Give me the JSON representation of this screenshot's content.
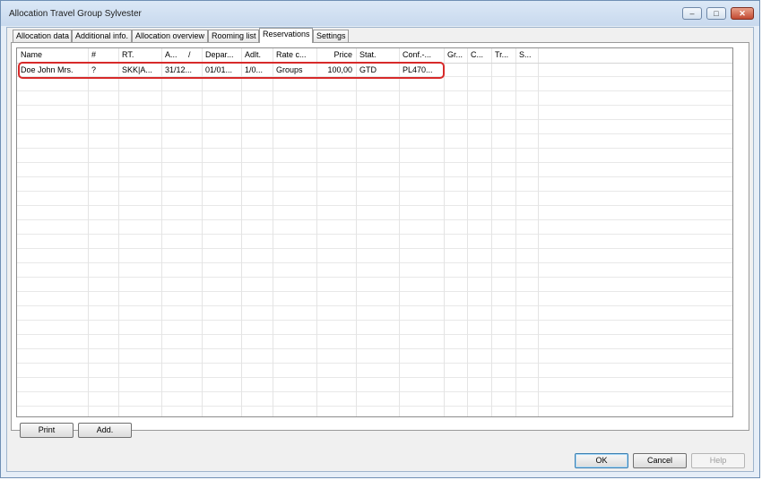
{
  "window": {
    "title": "Allocation Travel Group Sylvester"
  },
  "tabs": [
    {
      "label": "Allocation data"
    },
    {
      "label": "Additional info."
    },
    {
      "label": "Allocation overview"
    },
    {
      "label": "Rooming list"
    },
    {
      "label": "Reservations"
    },
    {
      "label": "Settings"
    }
  ],
  "grid": {
    "headers": {
      "name": "Name",
      "num": "#",
      "rt": "RT.",
      "arr": "A...",
      "sort": "/",
      "dep": "Depar...",
      "adlt": "Adlt.",
      "rate": "Rate c...",
      "price": "Price",
      "stat": "Stat.",
      "conf": "Conf.-...",
      "gr": "Gr...",
      "c": "C...",
      "tr": "Tr...",
      "s": "S..."
    },
    "rows": [
      {
        "name": "Doe John Mrs.",
        "num": "?",
        "rt": "SKK|A...",
        "arr": "31/12...",
        "dep": "01/01...",
        "adlt": "1/0...",
        "rate": "Groups",
        "price": "100,00",
        "stat": "GTD",
        "conf": "PL470...",
        "gr": "",
        "c": "",
        "tr": "",
        "s": ""
      }
    ]
  },
  "buttons": {
    "print": "Print",
    "add": "Add.",
    "ok": "OK",
    "cancel": "Cancel",
    "help": "Help"
  },
  "colors": {
    "highlight": "#d72a2a",
    "frame": "#6f8fb4"
  }
}
